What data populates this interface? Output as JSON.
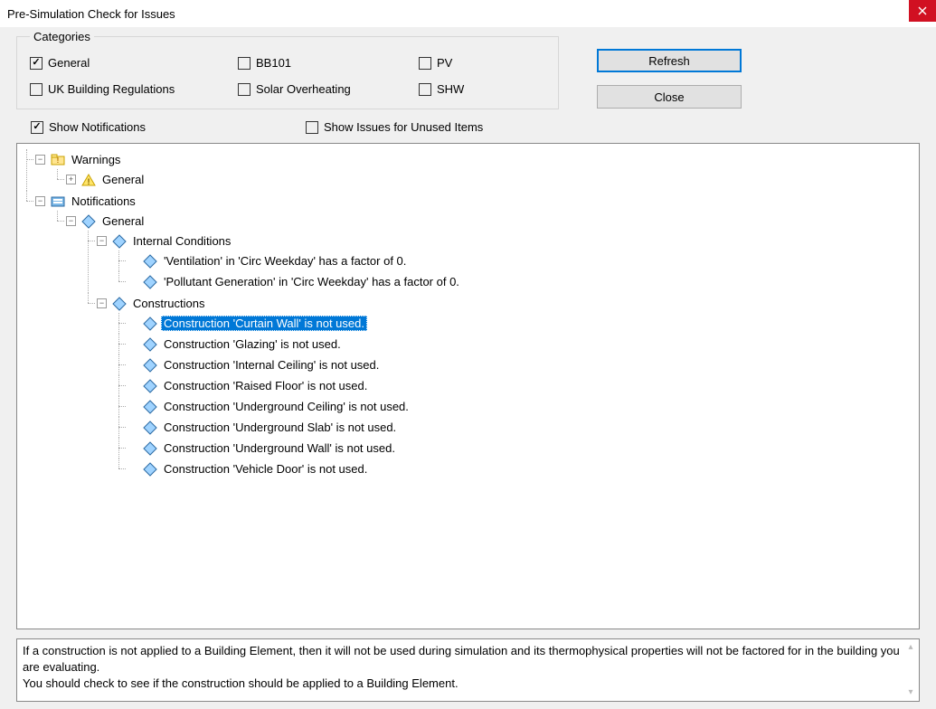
{
  "title": "Pre-Simulation Check for Issues",
  "categories_legend": "Categories",
  "categories": {
    "general": {
      "label": "General",
      "checked": true
    },
    "bb101": {
      "label": "BB101",
      "checked": false
    },
    "pv": {
      "label": "PV",
      "checked": false
    },
    "ukbr": {
      "label": "UK Building Regulations",
      "checked": false
    },
    "solar": {
      "label": "Solar Overheating",
      "checked": false
    },
    "shw": {
      "label": "SHW",
      "checked": false
    }
  },
  "buttons": {
    "refresh": "Refresh",
    "close": "Close"
  },
  "secondary": {
    "show_notifications": {
      "label": "Show Notifications",
      "checked": true
    },
    "show_unused": {
      "label": "Show Issues for Unused Items",
      "checked": false
    }
  },
  "tree": {
    "warnings": "Warnings",
    "warnings_general": "General",
    "notifications": "Notifications",
    "notif_general": "General",
    "internal_conditions": "Internal Conditions",
    "ic_item1": "'Ventilation' in 'Circ Weekday' has a factor of 0.",
    "ic_item2": "'Pollutant Generation' in 'Circ Weekday' has a factor of 0.",
    "constructions": "Constructions",
    "c_item1": "Construction 'Curtain Wall' is not used.",
    "c_item2": "Construction 'Glazing' is not used.",
    "c_item3": "Construction 'Internal Ceiling' is not used.",
    "c_item4": "Construction 'Raised Floor' is not used.",
    "c_item5": "Construction 'Underground Ceiling' is not used.",
    "c_item6": "Construction 'Underground Slab' is not used.",
    "c_item7": "Construction 'Underground Wall' is not used.",
    "c_item8": "Construction 'Vehicle Door' is not used."
  },
  "details": "If a construction is not applied to a Building Element, then it will not be used during simulation and its thermophysical properties will not be factored for in the building you are evaluating.\nYou should check to see if the construction should be applied to a Building Element."
}
